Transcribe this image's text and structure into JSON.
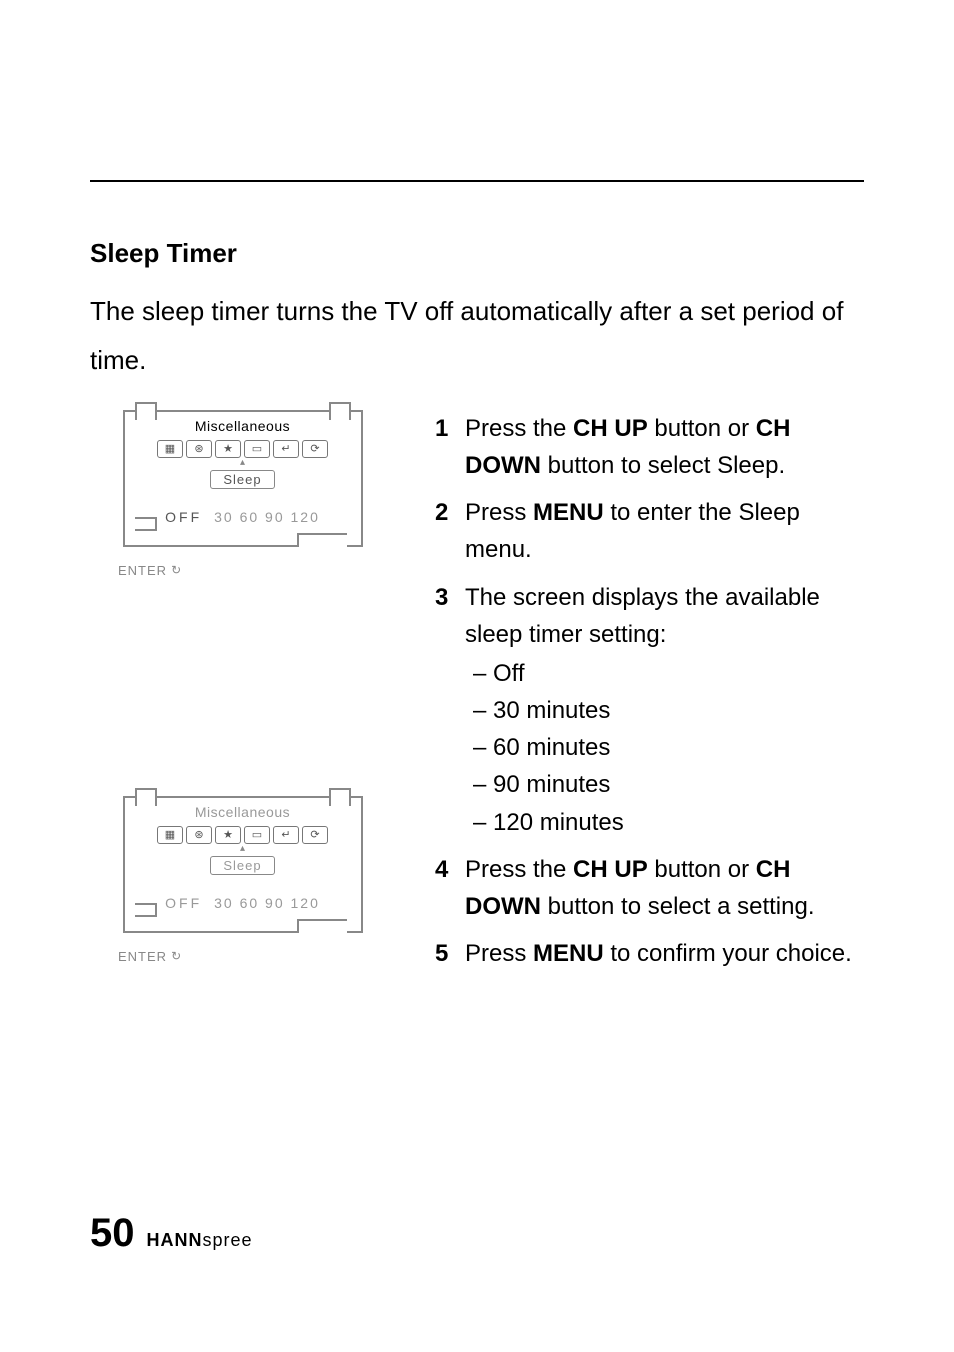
{
  "section": {
    "title": "Sleep Timer",
    "intro": "The sleep timer turns the TV off automatically after a set period of time."
  },
  "osd": {
    "title": "Miscellaneous",
    "label": "Sleep",
    "off": "OFF",
    "values": "30 60 90 120",
    "enter": "ENTER"
  },
  "steps": {
    "s1_a": "Press the ",
    "s1_b": "CH UP",
    "s1_c": " button or ",
    "s1_d": "CH DOWN",
    "s1_e": " button to select Sleep.",
    "s2_a": "Press ",
    "s2_b": "MENU",
    "s2_c": " to enter the Sleep menu.",
    "s3": "The screen displays the available sleep timer setting:",
    "s3_opts": {
      "o1": "Off",
      "o2": "30 minutes",
      "o3": "60 minutes",
      "o4": "90 minutes",
      "o5": "120 minutes"
    },
    "s4_a": "Press the ",
    "s4_b": "CH UP",
    "s4_c": " button or ",
    "s4_d": "CH DOWN",
    "s4_e": " button  to select a setting.",
    "s5_a": "Press ",
    "s5_b": "MENU",
    "s5_c": " to confirm your choice."
  },
  "footer": {
    "page": "50",
    "brand_bold": "HANN",
    "brand_light": "spree"
  }
}
